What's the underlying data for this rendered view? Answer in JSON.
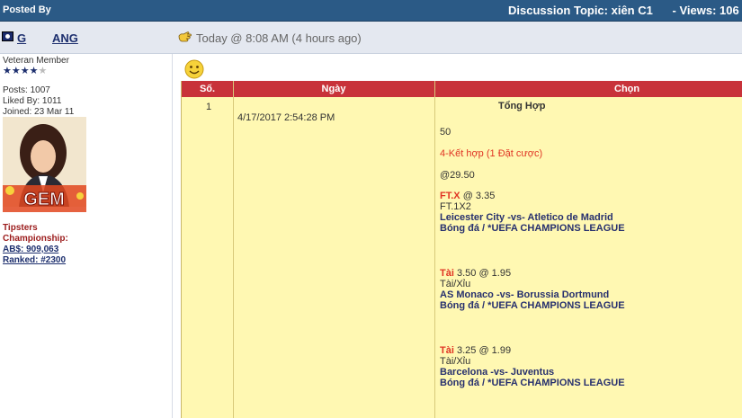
{
  "header": {
    "posted_by": "Posted By",
    "topic": "Discussion Topic: xiên C1",
    "views": "- Views: 106"
  },
  "user": {
    "name_part1": "G",
    "name_part2": "ANG",
    "posted_time": "Today @ 8:08 AM (4 hours ago)",
    "rank_title": "Veteran Member",
    "stars_filled": "★★★★",
    "stars_empty": "★",
    "posts": "Posts: 1007",
    "liked_by": "Liked By: 1011",
    "joined": "Joined: 23 Mar 11",
    "tipsters_label": "Tipsters",
    "championship_label": "Championship:",
    "abs": "AB$: 909,063",
    "ranked": "Ranked: #2300"
  },
  "table": {
    "headers": [
      "Số.",
      "Ngày",
      "Chọn"
    ],
    "row_number": "1",
    "date": "4/17/2017 2:54:28 PM",
    "summary_title": "Tổng Hợp",
    "stake": "50",
    "combo": "4-Kết hợp (1 Đặt cược)",
    "total_odds": "@29.50",
    "bets": [
      {
        "pick": "FT.X",
        "odds": "@ 3.35",
        "market": "FT.1X2",
        "match": "Leicester City -vs- Atletico de Madrid",
        "league": "Bóng đá / *UEFA CHAMPIONS LEAGUE"
      },
      {
        "pick": "Tài",
        "pick_extra": "3.50",
        "odds": "@ 1.95",
        "market": "Tài/Xỉu",
        "match": "AS Monaco -vs- Borussia Dortmund",
        "league": "Bóng đá / *UEFA CHAMPIONS LEAGUE"
      },
      {
        "pick": "Tài",
        "pick_extra": "3.25",
        "odds": "@ 1.99",
        "market": "Tài/Xỉu",
        "match": "Barcelona -vs- Juventus",
        "league": "Bóng đá / *UEFA CHAMPIONS LEAGUE"
      }
    ]
  },
  "colors": {
    "topbar": "#2b5a86",
    "table_header": "#c8323a",
    "table_body": "#fff8b2",
    "pick_red": "#e03524",
    "match_navy": "#27306e"
  },
  "icons": [
    "flag-icon",
    "post-hand-icon",
    "smiley-icon"
  ]
}
